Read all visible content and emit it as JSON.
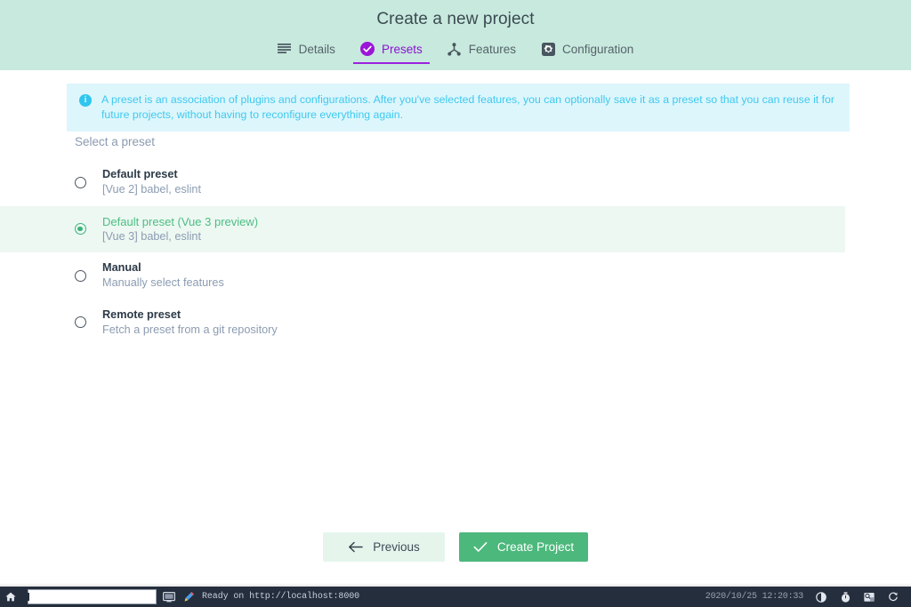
{
  "header": {
    "title": "Create a new project",
    "tabs": [
      {
        "label": "Details",
        "icon": "list-lines-icon",
        "active": false
      },
      {
        "label": "Presets",
        "icon": "check-circle-icon",
        "active": true
      },
      {
        "label": "Features",
        "icon": "hierarchy-icon",
        "active": false
      },
      {
        "label": "Configuration",
        "icon": "gear-square-icon",
        "active": false
      }
    ],
    "active_tab": "Presets",
    "bg_color": "#c8e9dd",
    "accent_color": "#9b22e0"
  },
  "banner": {
    "icon": "info-icon",
    "icon_glyph": "i",
    "text": "A preset is an association of plugins and configurations. After you've selected features, you can optionally save it as a preset so that you can reuse it for future projects, without having to reconfigure everything again.",
    "bg_color": "#ddf6fc",
    "text_color": "#3ec9ef"
  },
  "main": {
    "section_label": "Select a preset",
    "presets": [
      {
        "title": "Default preset",
        "description": "[Vue 2] babel, eslint",
        "selected": false
      },
      {
        "title": "Default preset (Vue 3 preview)",
        "description": "[Vue 3] babel, eslint",
        "selected": true
      },
      {
        "title": "Manual",
        "description": "Manually select features",
        "selected": false
      },
      {
        "title": "Remote preset",
        "description": "Fetch a preset from a git repository",
        "selected": false
      }
    ],
    "selected_color": "#4cbd84",
    "selected_row_bg": "#edf8f2"
  },
  "footer": {
    "previous_label": "Previous",
    "previous_icon": "arrow-left-icon",
    "create_label": "Create Project",
    "create_icon": "check-icon",
    "create_color": "#4cb87c"
  },
  "taskbar": {
    "home_icon": "home-icon",
    "window_item_label": "",
    "monitor_icon": "monitor-icon",
    "pencil_icon": "pencil-icon",
    "status": "Ready on http://localhost:8000",
    "clock": "2020/10/25 12:20:33",
    "tray": [
      {
        "icon": "brightness-icon"
      },
      {
        "icon": "timer-icon"
      },
      {
        "icon": "keyboard-layout-icon"
      },
      {
        "icon": "refresh-icon"
      }
    ],
    "bg_color": "#252e3d"
  }
}
